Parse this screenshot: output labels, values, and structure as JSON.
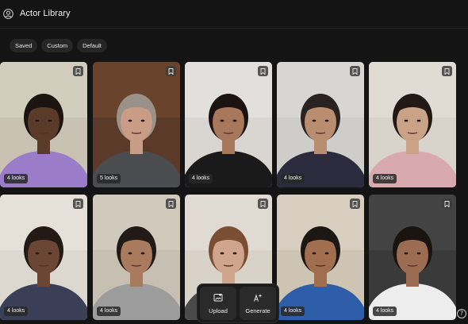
{
  "header": {
    "title": "Actor Library",
    "user_icon": "user-circle-icon"
  },
  "filters": [
    "Saved",
    "Custom",
    "Default"
  ],
  "actors": [
    {
      "looks": "4 looks",
      "bg": "#c9c2b2",
      "wall": "#d9d3c5",
      "skin": "#5a3a28",
      "hair": "#1c1410",
      "shirt": "#9a7cc9"
    },
    {
      "looks": "5 looks",
      "bg": "#5b3a2a",
      "wall": "#74492f",
      "skin": "#c99c85",
      "hair": "#9a9288",
      "shirt": "#4a4c50"
    },
    {
      "looks": "4 looks",
      "bg": "#d9d6d2",
      "wall": "#e8e6e3",
      "skin": "#a8785c",
      "hair": "#1b1311",
      "shirt": "#1a1a1a"
    },
    {
      "looks": "4 looks",
      "bg": "#cfcdc9",
      "wall": "#dedcd8",
      "skin": "#b98d70",
      "hair": "#2a2220",
      "shirt": "#2c2b3e"
    },
    {
      "looks": "4 looks",
      "bg": "#d8d3cb",
      "wall": "#e6e1d9",
      "skin": "#c9a288",
      "hair": "#221915",
      "shirt": "#d9a9b0"
    },
    {
      "looks": "4 looks",
      "bg": "#dcd8d0",
      "wall": "#ebe7df",
      "skin": "#6b4634",
      "hair": "#231a16",
      "shirt": "#3a3f57"
    },
    {
      "looks": "4 looks",
      "bg": "#c7bfb2",
      "wall": "#d8d1c4",
      "skin": "#a97a5d",
      "hair": "#221a16",
      "shirt": "#9c9c9c"
    },
    {
      "looks": "",
      "bg": "#d8d2c8",
      "wall": "#e6e1d8",
      "skin": "#d0a58d",
      "hair": "#7a4e32",
      "shirt": "#4a4a4a"
    },
    {
      "looks": "4 looks",
      "bg": "#cdc4b4",
      "wall": "#ddd5c6",
      "skin": "#a16f50",
      "hair": "#1d1714",
      "shirt": "#2f5ea8"
    },
    {
      "looks": "4 looks",
      "bg": "#3a3a3a",
      "wall": "#4a4a4a",
      "skin": "#9c6c52",
      "hair": "#1a1410",
      "shirt": "#ededed"
    }
  ],
  "actions": [
    {
      "label": "Upload",
      "icon": "upload-image-icon"
    },
    {
      "label": "Generate",
      "icon": "ai-sparkle-icon"
    }
  ],
  "help_label": "?"
}
